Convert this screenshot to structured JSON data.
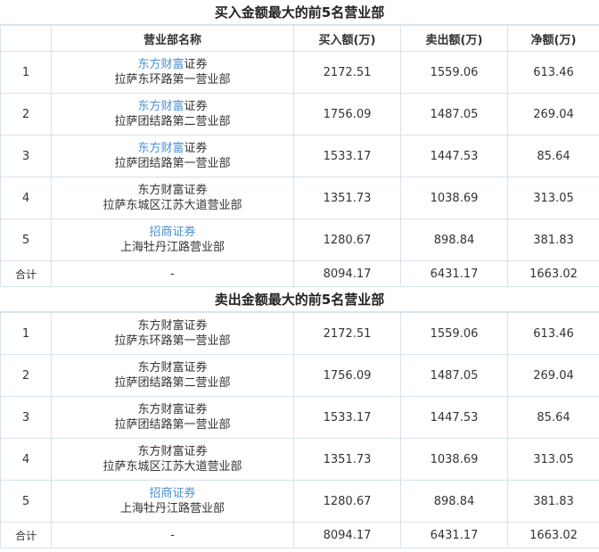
{
  "buy_section": {
    "title": "买入金额最大的前5名营业部",
    "headers": [
      "",
      "营业部名称",
      "买入额(万)",
      "卖出额(万)",
      "净额(万)"
    ],
    "rows": [
      {
        "rank": "1",
        "firm_link": "东方财富",
        "firm_rest": "证券",
        "branch": "拉萨东环路第一营业部",
        "buy": "2172.51",
        "sell": "1559.06",
        "net": "613.46"
      },
      {
        "rank": "2",
        "firm_link": "东方财富",
        "firm_rest": "证券",
        "branch": "拉萨团结路第二营业部",
        "buy": "1756.09",
        "sell": "1487.05",
        "net": "269.04"
      },
      {
        "rank": "3",
        "firm_link": "东方财富",
        "firm_rest": "证券",
        "branch": "拉萨团结路第一营业部",
        "buy": "1533.17",
        "sell": "1447.53",
        "net": "85.64"
      },
      {
        "rank": "4",
        "firm_link": "",
        "firm_rest": "东方财富证券",
        "branch": "拉萨东城区江苏大道营业部",
        "buy": "1351.73",
        "sell": "1038.69",
        "net": "313.05"
      },
      {
        "rank": "5",
        "firm_link": "招商证券",
        "firm_rest": "",
        "branch": "上海牡丹江路营业部",
        "buy": "1280.67",
        "sell": "898.84",
        "net": "381.83"
      }
    ],
    "total": {
      "label": "合计",
      "name": "-",
      "buy": "8094.17",
      "sell": "6431.17",
      "net": "1663.02"
    }
  },
  "sell_section": {
    "title": "卖出金额最大的前5名营业部",
    "rows": [
      {
        "rank": "1",
        "firm_link": "",
        "firm_rest": "东方财富证券",
        "branch": "拉萨东环路第一营业部",
        "buy": "2172.51",
        "sell": "1559.06",
        "net": "613.46"
      },
      {
        "rank": "2",
        "firm_link": "",
        "firm_rest": "东方财富证券",
        "branch": "拉萨团结路第二营业部",
        "buy": "1756.09",
        "sell": "1487.05",
        "net": "269.04"
      },
      {
        "rank": "3",
        "firm_link": "",
        "firm_rest": "东方财富证券",
        "branch": "拉萨团结路第一营业部",
        "buy": "1533.17",
        "sell": "1447.53",
        "net": "85.64"
      },
      {
        "rank": "4",
        "firm_link": "",
        "firm_rest": "东方财富证券",
        "branch": "拉萨东城区江苏大道营业部",
        "buy": "1351.73",
        "sell": "1038.69",
        "net": "313.05"
      },
      {
        "rank": "5",
        "firm_link": "招商证券",
        "firm_rest": "",
        "branch": "上海牡丹江路营业部",
        "buy": "1280.67",
        "sell": "898.84",
        "net": "381.83"
      }
    ],
    "total": {
      "label": "合计",
      "name": "-",
      "buy": "8094.17",
      "sell": "6431.17",
      "net": "1663.02"
    }
  },
  "colors": {
    "link": "#4a90d9",
    "border": "#d7e3f0",
    "text": "#333333"
  }
}
